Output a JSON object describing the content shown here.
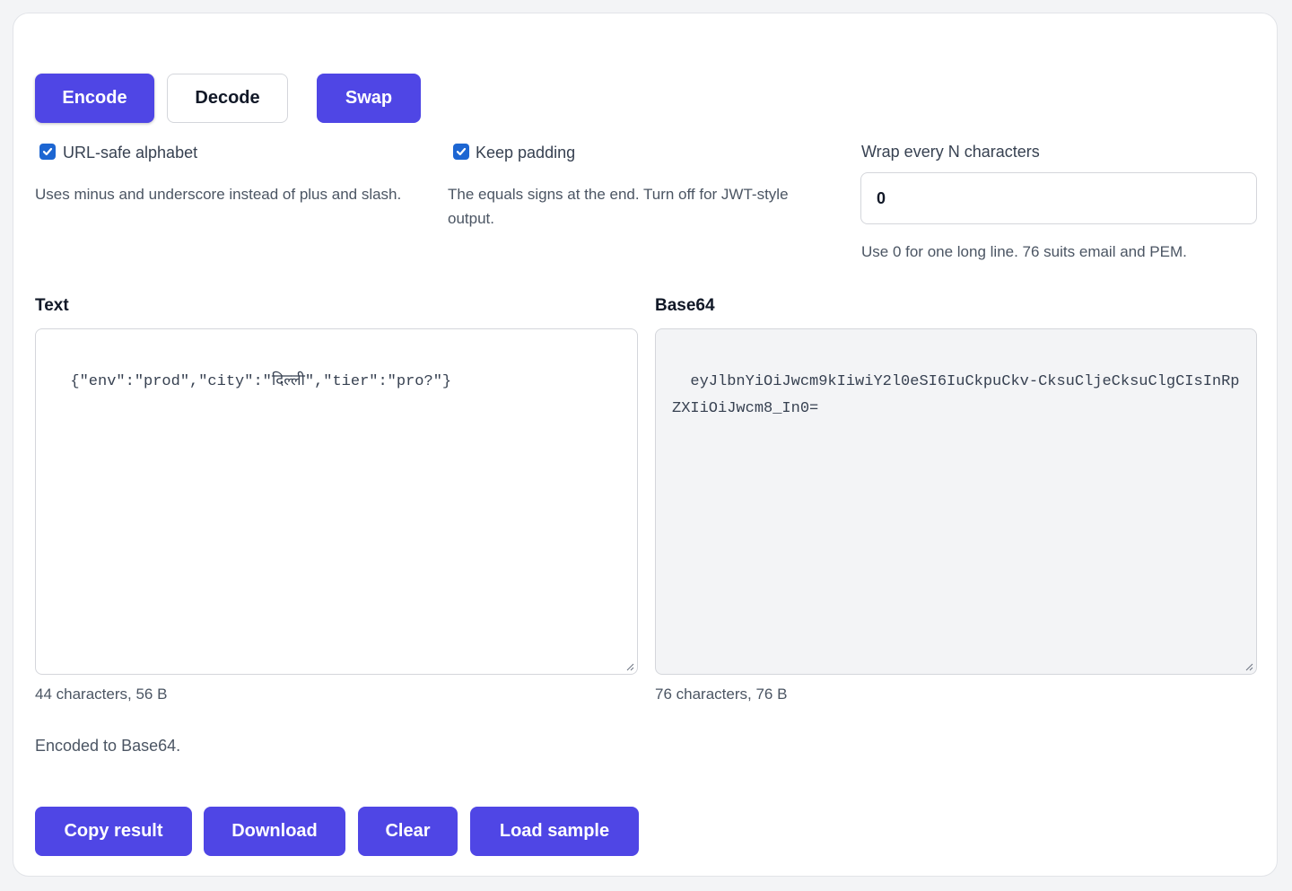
{
  "mode": {
    "encode_label": "Encode",
    "decode_label": "Decode",
    "swap_label": "Swap"
  },
  "options": {
    "url_safe": {
      "label": "URL-safe alphabet",
      "checked": true,
      "hint": "Uses minus and underscore instead of plus and slash."
    },
    "keep_padding": {
      "label": "Keep padding",
      "checked": true,
      "hint": "The equals signs at the end. Turn off for JWT-style output."
    },
    "wrap": {
      "label": "Wrap every N characters",
      "value": "0",
      "hint": "Use 0 for one long line. 76 suits email and PEM."
    }
  },
  "text_panel": {
    "label": "Text",
    "value": "{\"env\":\"prod\",\"city\":\"दिल्ली\",\"tier\":\"pro?\"}",
    "meta": "44 characters, 56 B"
  },
  "base64_panel": {
    "label": "Base64",
    "value": "eyJlbnYiOiJwcm9kIiwiY2l0eSI6IuCkpuCkv-CksuClje​CksuClgCIsInRpZXIiOiJwcm8_In0=",
    "meta": "76 characters, 76 B"
  },
  "status": "Encoded to Base64.",
  "actions": {
    "copy_label": "Copy result",
    "download_label": "Download",
    "clear_label": "Clear",
    "sample_label": "Load sample"
  },
  "colors": {
    "accent": "#4f46e5",
    "checkbox": "#1d66d2"
  }
}
